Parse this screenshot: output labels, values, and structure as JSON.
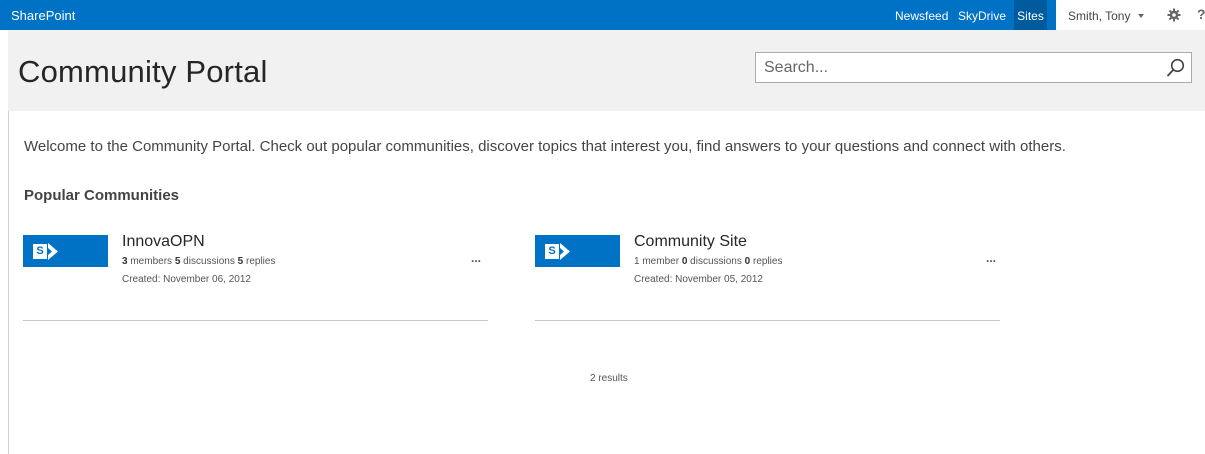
{
  "suite_bar": {
    "brand": "SharePoint",
    "links": [
      {
        "label": "Newsfeed",
        "active": false
      },
      {
        "label": "SkyDrive",
        "active": false
      },
      {
        "label": "Sites",
        "active": true
      }
    ],
    "user_name": "Smith, Tony",
    "settings_icon": "gear-icon",
    "help_label": "?"
  },
  "header": {
    "site_title": "Community Portal",
    "search_placeholder": "Search...",
    "search_icon": "search-icon"
  },
  "main": {
    "welcome_text": "Welcome to the Community Portal. Check out popular communities, discover topics that interest you, find answers to your questions and connect with others.",
    "section_title": "Popular Communities",
    "communities": [
      {
        "title": "InnovaOPN",
        "members_count": "3",
        "members_label": "members",
        "discussions_count": "5",
        "discussions_label": "discussions",
        "replies_count": "5",
        "replies_label": "replies",
        "created": "Created: November 06, 2012",
        "more_label": "..."
      },
      {
        "title": "Community Site",
        "members_count": "1",
        "members_label": "member",
        "discussions_count": "0",
        "discussions_label": "discussions",
        "replies_count": "0",
        "replies_label": "replies",
        "created": "Created: November 05, 2012",
        "more_label": "..."
      }
    ],
    "results_text": "2 results"
  },
  "colors": {
    "suite_bar": "#0072c6",
    "active_link": "#005a9e",
    "header_bg": "#f1f1f1",
    "tile": "#0072c6"
  }
}
